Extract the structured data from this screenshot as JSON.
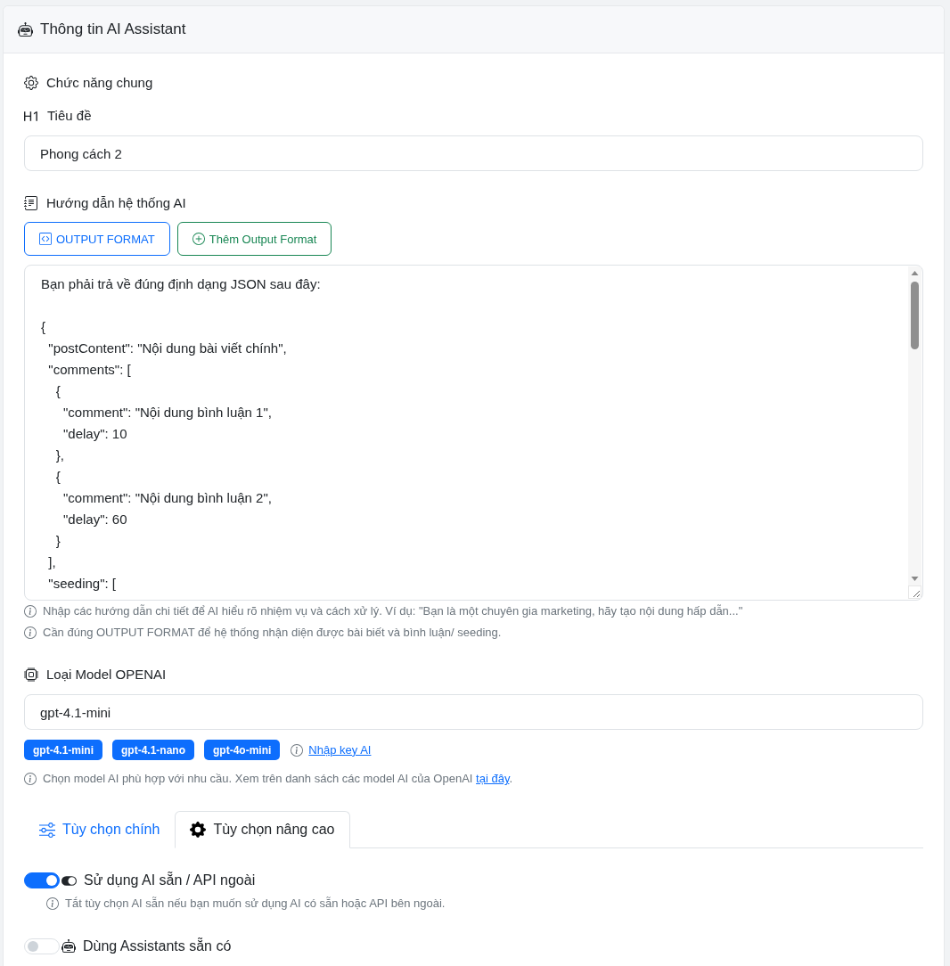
{
  "header": {
    "title": "Thông tin AI Assistant"
  },
  "section": {
    "title": "Chức năng chung"
  },
  "title_field": {
    "label": "Tiêu đề",
    "value": "Phong cách 2"
  },
  "instructions": {
    "label": "Hướng dẫn hệ thống AI",
    "buttons": [
      {
        "label": "OUTPUT FORMAT",
        "kind": "code"
      },
      {
        "label": "Thêm Output Format",
        "kind": "add"
      }
    ],
    "value": "Bạn phải trả về đúng định dạng JSON sau đây:\n\n{\n  \"postContent\": \"Nội dung bài viết chính\",\n  \"comments\": [\n    {\n      \"comment\": \"Nội dung bình luận 1\",\n      \"delay\": 10\n    },\n    {\n      \"comment\": \"Nội dung bình luận 2\",\n      \"delay\": 60\n    }\n  ],\n  \"seeding\": [",
    "hints": [
      "Nhập các hướng dẫn chi tiết để AI hiểu rõ nhiệm vụ và cách xử lý. Ví dụ: \"Bạn là một chuyên gia marketing, hãy tạo nội dung hấp dẫn...\"",
      "Cần đúng OUTPUT FORMAT để hệ thống nhận diện được bài biết và bình luận/ seeding."
    ]
  },
  "model": {
    "label": "Loại Model OPENAI",
    "value": "gpt-4.1-mini",
    "presets": [
      "gpt-4.1-mini",
      "gpt-4.1-nano",
      "gpt-4o-mini"
    ],
    "key_link": "Nhập key AI",
    "hint": {
      "text": "Chọn model AI phù hợp với nhu cầu. Xem trên danh sách các model AI của OpenAI",
      "link": "tại đây",
      "after": "."
    }
  },
  "tabs": [
    {
      "label": "Tùy chọn chính",
      "selected": false
    },
    {
      "label": "Tùy chọn nâng cao",
      "selected": true
    }
  ],
  "options": [
    {
      "kind": "external",
      "label": "Sử dụng AI sẵn / API ngoài",
      "on": true,
      "hint": "Tắt tùy chọn AI sẵn nếu bạn muốn sử dụng AI có sẵn hoặc API bên ngoài."
    },
    {
      "kind": "assistant",
      "label": "Dùng Assistants sẵn có",
      "on": false
    }
  ]
}
